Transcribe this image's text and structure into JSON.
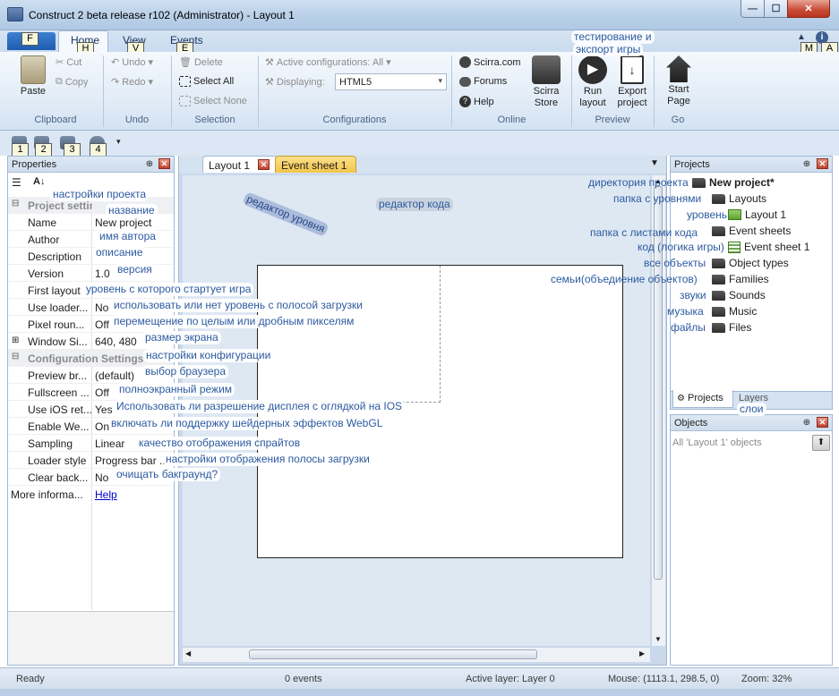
{
  "window": {
    "title": "Construct 2 beta release r102 (Administrator) - Layout 1"
  },
  "ribbon": {
    "tabs": [
      {
        "label": "Home",
        "keytip": "H"
      },
      {
        "label": "View",
        "keytip": "V"
      },
      {
        "label": "Events",
        "keytip": "E"
      }
    ],
    "file_keytip": "F",
    "right_keytips": [
      "M",
      "A"
    ],
    "clipboard": {
      "paste": "Paste",
      "cut": "Cut",
      "copy": "Copy",
      "label": "Clipboard"
    },
    "undo": {
      "undo": "Undo",
      "redo": "Redo",
      "label": "Undo"
    },
    "selection": {
      "delete": "Delete",
      "select_all": "Select All",
      "select_none": "Select None",
      "label": "Selection"
    },
    "configurations": {
      "active": "Active configurations: All",
      "displaying_label": "Displaying:",
      "displaying_value": "HTML5",
      "label": "Configurations"
    },
    "online": {
      "scirra": "Scirra.com",
      "forums": "Forums",
      "help": "Help",
      "store_line1": "Scirra",
      "store_line2": "Store",
      "label": "Online"
    },
    "preview": {
      "run_line1": "Run",
      "run_line2": "layout",
      "export_line1": "Export",
      "export_line2": "project",
      "label": "Preview"
    },
    "go": {
      "start_line1": "Start",
      "start_line2": "Page",
      "label": "Go"
    }
  },
  "qat": {
    "keytips": [
      "1",
      "2",
      "3",
      "4"
    ]
  },
  "properties": {
    "title": "Properties",
    "cat_project": "Project settings",
    "cat_config": "Configuration Settings",
    "rows": [
      {
        "name": "Name",
        "value": "New project"
      },
      {
        "name": "Author",
        "value": ""
      },
      {
        "name": "Description",
        "value": ""
      },
      {
        "name": "Version",
        "value": "1.0"
      },
      {
        "name": "First layout",
        "value": ""
      },
      {
        "name": "Use loader...",
        "value": "No"
      },
      {
        "name": "Pixel roun...",
        "value": "Off"
      },
      {
        "name": "Window Si...",
        "value": "640, 480"
      }
    ],
    "config_rows": [
      {
        "name": "Preview br...",
        "value": "(default)"
      },
      {
        "name": "Fullscreen ...",
        "value": "Off"
      },
      {
        "name": "Use iOS ret...",
        "value": "Yes"
      },
      {
        "name": "Enable We...",
        "value": "On"
      },
      {
        "name": "Sampling",
        "value": "Linear"
      },
      {
        "name": "Loader style",
        "value": "Progress bar ..."
      },
      {
        "name": "Clear back...",
        "value": "No"
      }
    ],
    "more_info": "More informa...",
    "help_link": "Help"
  },
  "doc_tabs": [
    {
      "label": "Layout 1"
    },
    {
      "label": "Event sheet 1"
    }
  ],
  "projects": {
    "title": "Projects",
    "root": "New project*",
    "items": {
      "layouts": "Layouts",
      "layout1": "Layout 1",
      "event_sheets": "Event sheets",
      "event_sheet1": "Event sheet 1",
      "object_types": "Object types",
      "families": "Families",
      "sounds": "Sounds",
      "music": "Music",
      "files": "Files"
    },
    "tab_projects": "Projects",
    "tab_layers": "Layers"
  },
  "objects": {
    "title": "Objects",
    "filter": "All 'Layout 1' objects"
  },
  "status": {
    "ready": "Ready",
    "events": "0 events",
    "active_layer": "Active layer: Layer 0",
    "mouse": "Mouse: (1113.1, 298.5, 0)",
    "zoom": "Zoom: 32%"
  },
  "annotations": {
    "testing_export": "тестирование и",
    "testing_export2": "экспорт игры",
    "project_settings": "настройки проекта",
    "name": "название",
    "author": "имя автора",
    "description": "описание",
    "version": "версия",
    "first_layout": "уровень с которого стартует игра",
    "use_loader": "использовать или нет уровень с полосой загрузки",
    "pixel_rounding": "перемещение по целым или дробным пикселям",
    "window_size": "размер экрана",
    "config_settings": "настройки конфигурации",
    "preview_browser": "выбор браузера",
    "fullscreen": "полноэкранный режим",
    "ios_retina": "Использовать ли разрешение дисплея с оглядкой на IOS",
    "webgl": "включать ли поддержку шейдерных эффектов WebGL",
    "sampling": "качество отображения спрайтов",
    "loader_style": "настройки отображения полосы загрузки",
    "clear_bg": "очищать бакграунд?",
    "layout_editor": "редактор уровня",
    "code_editor": "редактор кода",
    "project_dir": "директория проекта",
    "layouts_folder": "папка с уровнями",
    "layout": "уровень",
    "event_sheets_folder": "папка с листами кода",
    "code": "код (логика игры)",
    "all_objects": "все объекты",
    "families": "семьи(объедиение объектов)",
    "sounds": "звуки",
    "music": "музыка",
    "files": "файлы",
    "layers": "слои"
  }
}
